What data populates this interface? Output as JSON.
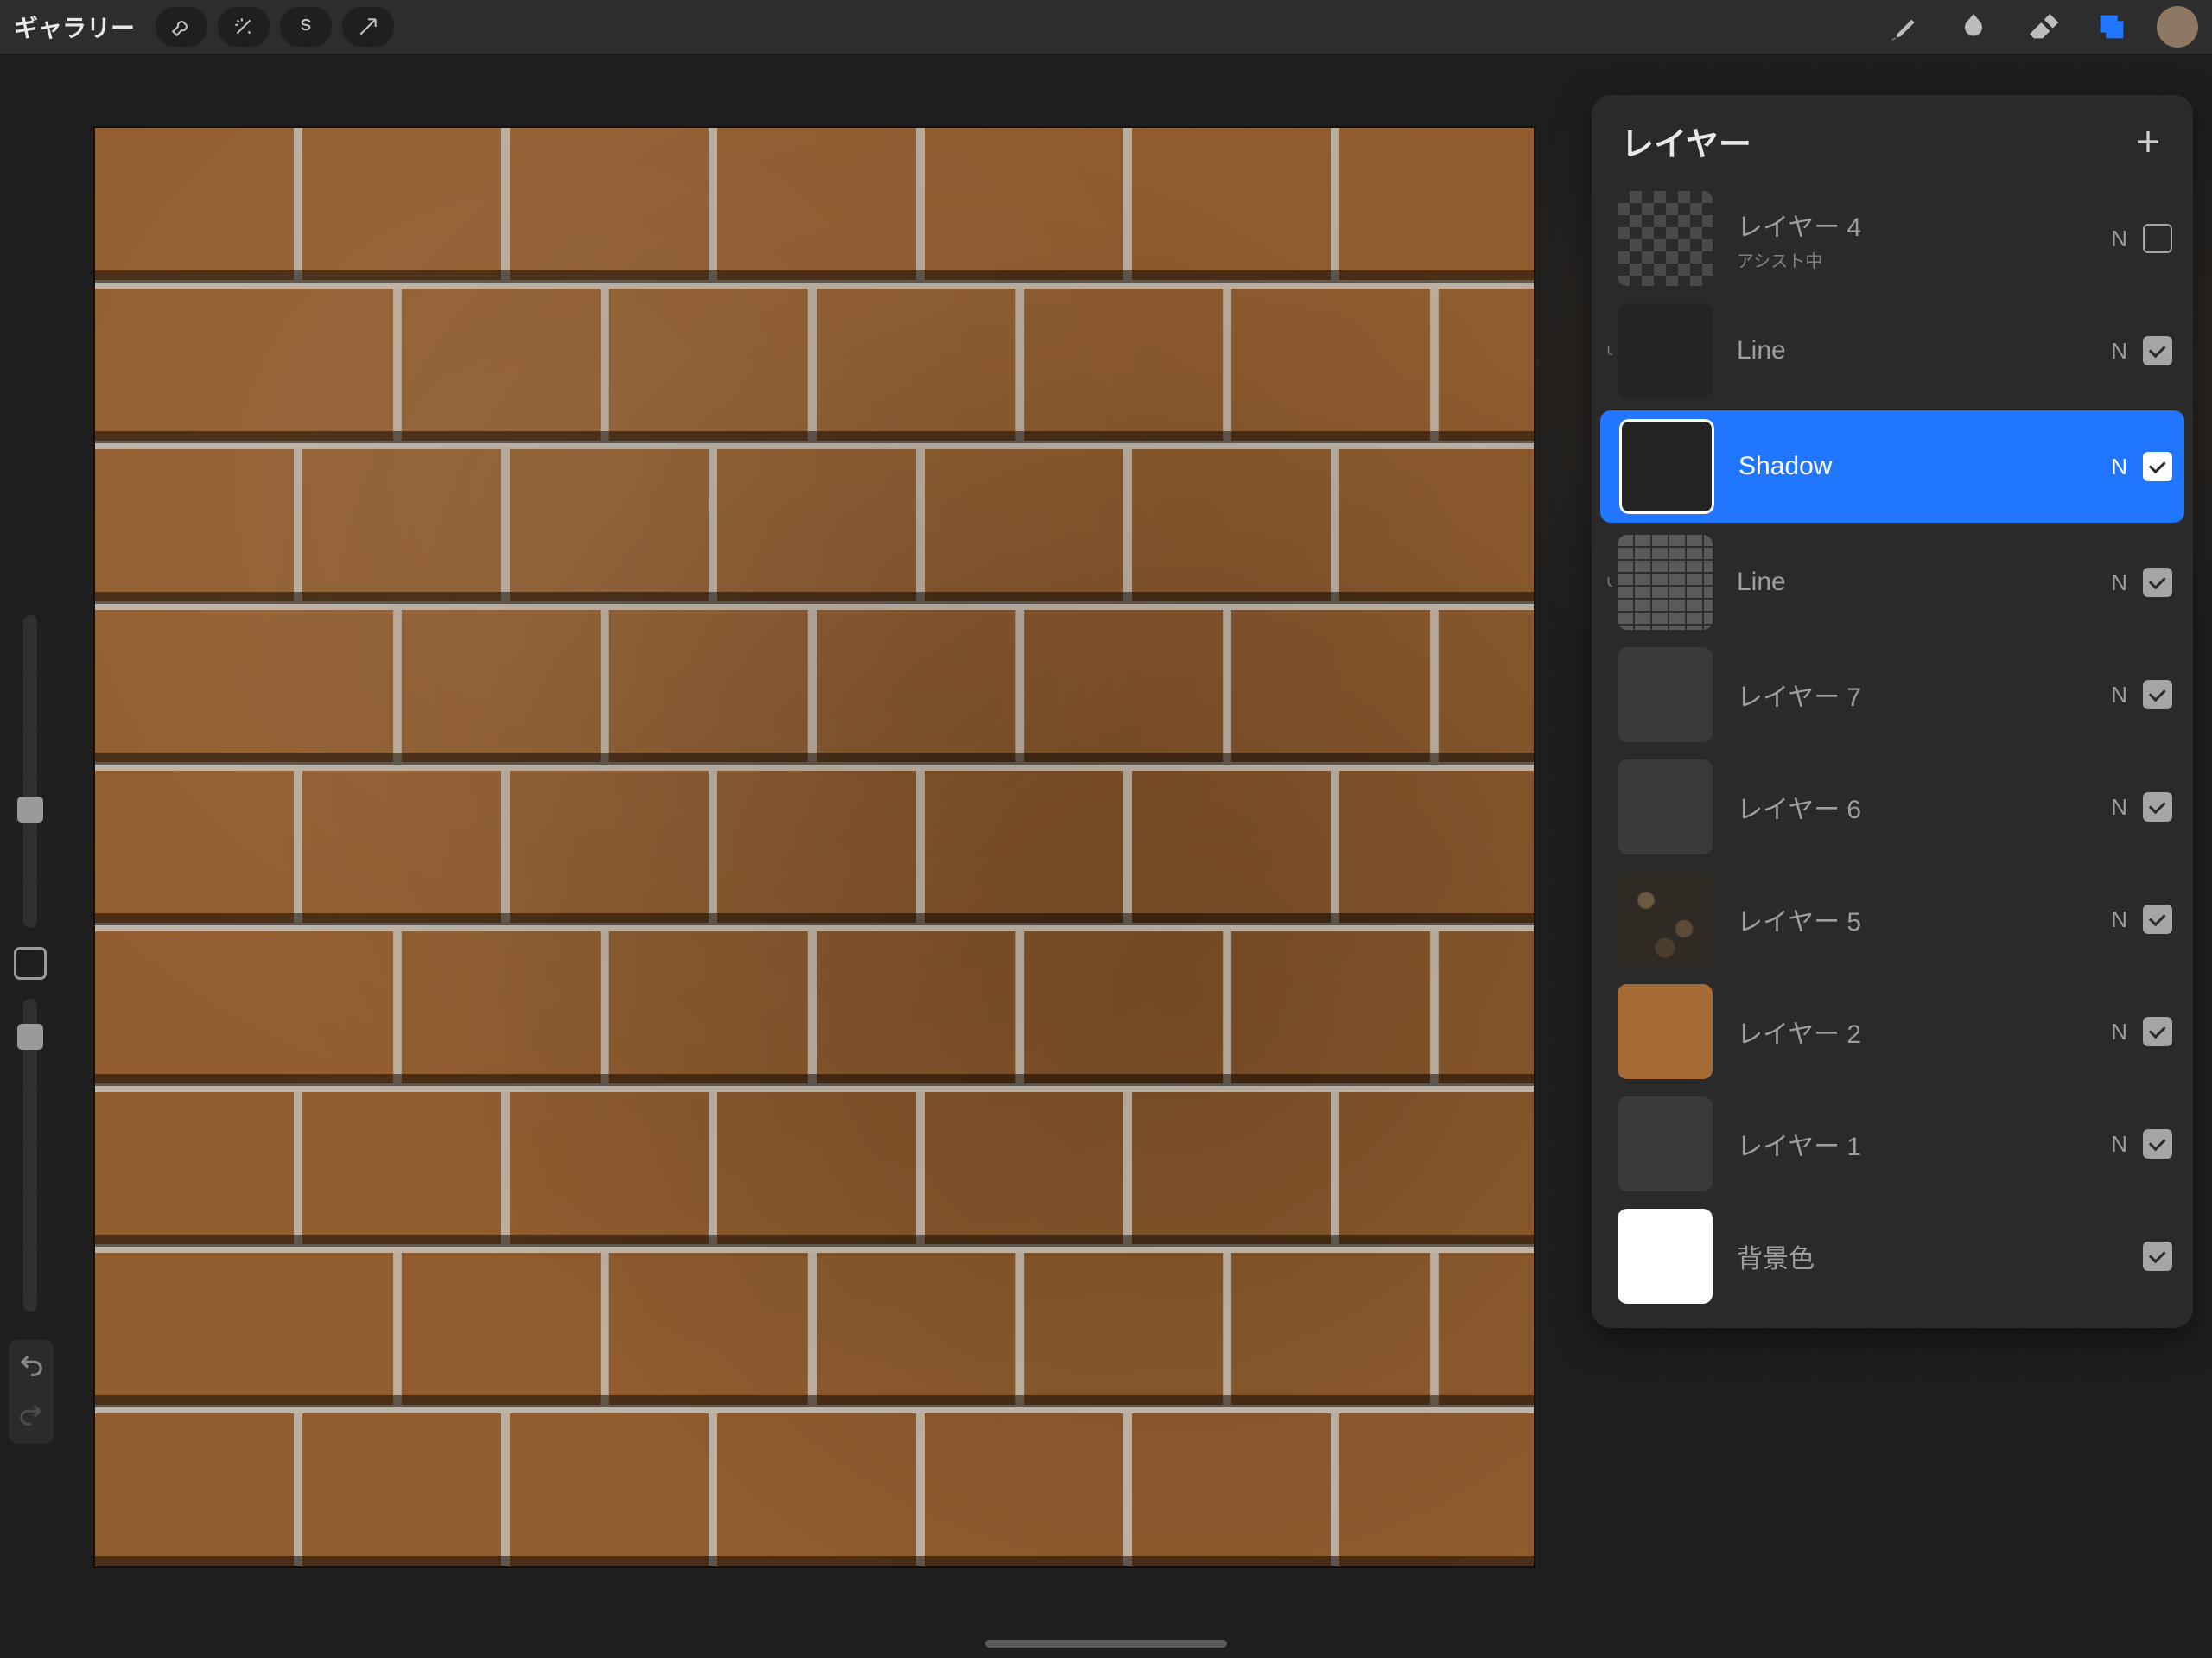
{
  "app": {
    "gallery_label": "ギャラリー"
  },
  "panel": {
    "title": "レイヤー"
  },
  "blend_letter": "N",
  "layers": [
    {
      "name": "レイヤー 4",
      "sub": "アシスト中",
      "blend": "N",
      "visible": false,
      "thumb": "checker",
      "mask": false,
      "selected": false
    },
    {
      "name": "Line",
      "sub": "",
      "blend": "N",
      "visible": true,
      "thumb": "dark",
      "mask": true,
      "selected": false
    },
    {
      "name": "Shadow",
      "sub": "",
      "blend": "N",
      "visible": true,
      "thumb": "dark",
      "mask": false,
      "selected": true
    },
    {
      "name": "Line",
      "sub": "",
      "blend": "N",
      "visible": true,
      "thumb": "brick",
      "mask": true,
      "selected": false
    },
    {
      "name": "レイヤー 7",
      "sub": "",
      "blend": "N",
      "visible": true,
      "thumb": "grey",
      "mask": false,
      "selected": false
    },
    {
      "name": "レイヤー 6",
      "sub": "",
      "blend": "N",
      "visible": true,
      "thumb": "grey",
      "mask": false,
      "selected": false
    },
    {
      "name": "レイヤー 5",
      "sub": "",
      "blend": "N",
      "visible": true,
      "thumb": "noisy",
      "mask": false,
      "selected": false
    },
    {
      "name": "レイヤー 2",
      "sub": "",
      "blend": "N",
      "visible": true,
      "thumb": "orange",
      "mask": false,
      "selected": false
    },
    {
      "name": "レイヤー 1",
      "sub": "",
      "blend": "N",
      "visible": true,
      "thumb": "grey",
      "mask": false,
      "selected": false
    },
    {
      "name": "背景色",
      "sub": "",
      "blend": "",
      "visible": true,
      "thumb": "white",
      "mask": false,
      "selected": false
    }
  ],
  "colors": {
    "accent": "#2176ff",
    "current_color": "#8c7864"
  }
}
